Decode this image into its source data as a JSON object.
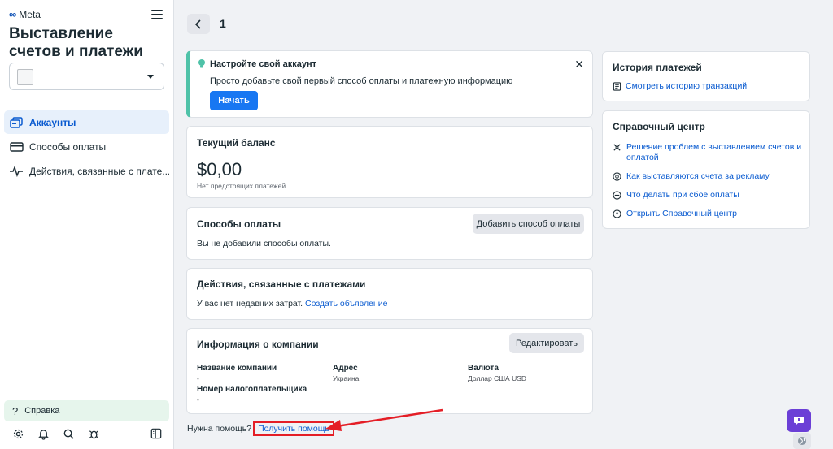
{
  "sidebar": {
    "logo_text": "Meta",
    "title": "Выставление счетов и платежи",
    "nav": [
      {
        "label": "Аккаунты"
      },
      {
        "label": "Способы оплаты"
      },
      {
        "label": "Действия, связанные с плате..."
      }
    ],
    "help_label": "Справка"
  },
  "header": {
    "page": "1"
  },
  "setup": {
    "title": "Настройте свой аккаунт",
    "desc": "Просто добавьте свой первый способ оплаты и платежную информацию",
    "start_label": "Начать"
  },
  "balance": {
    "title": "Текущий баланс",
    "amount": "$0,00",
    "sub": "Нет предстоящих платежей."
  },
  "methods": {
    "title": "Способы оплаты",
    "add_label": "Добавить способ оплаты",
    "empty": "Вы не добавили способы оплаты."
  },
  "actions": {
    "title": "Действия, связанные с платежами",
    "empty": "У вас нет недавних затрат.",
    "create_link": "Создать объявление"
  },
  "company": {
    "title": "Информация о компании",
    "edit_label": "Редактировать",
    "name_label": "Название компании",
    "name_value": "-",
    "tax_label": "Номер налогоплательщика",
    "tax_value": "-",
    "address_label": "Адрес",
    "address_value": "Украина",
    "currency_label": "Валюта",
    "currency_value": "Доллар США USD"
  },
  "footer": {
    "need_help": "Нужна помощь?",
    "get_help": "Получить помощь"
  },
  "history": {
    "title": "История платежей",
    "link": "Смотреть историю транзакций"
  },
  "helpcenter": {
    "title": "Справочный центр",
    "items": [
      {
        "label": "Решение проблем с выставлением счетов и оплатой"
      },
      {
        "label": "Как выставляются счета за рекламу"
      },
      {
        "label": "Что делать при сбое оплаты"
      },
      {
        "label": "Открыть Справочный центр"
      }
    ]
  },
  "colors": {
    "primary": "#1877f2",
    "link": "#0a5bd0",
    "accent_bar": "#4fc2a8",
    "highlight": "#e41e26",
    "chat": "#6b3fd6"
  }
}
